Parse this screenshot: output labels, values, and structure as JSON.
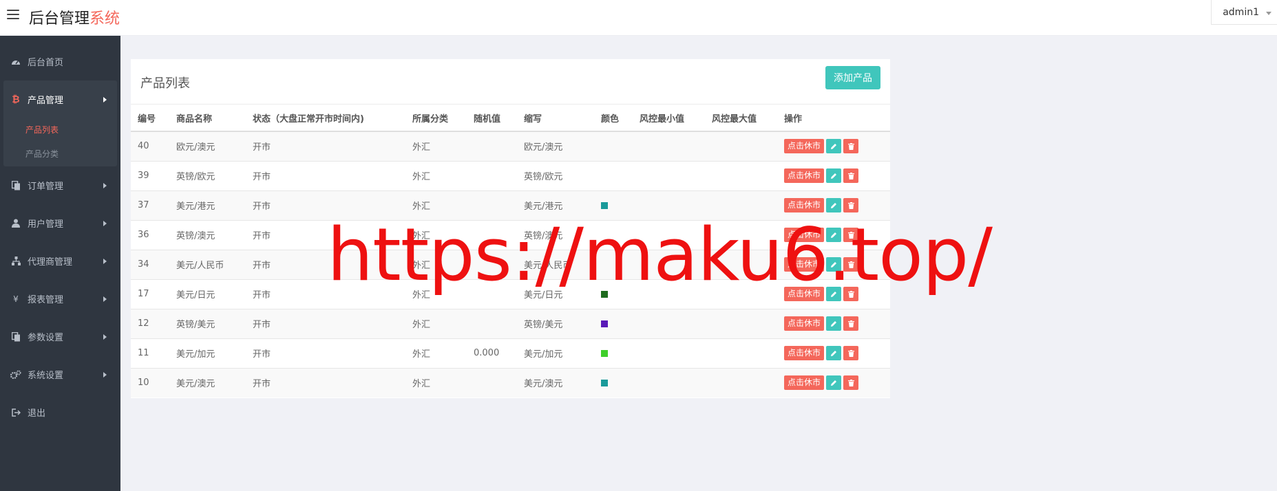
{
  "header": {
    "brand_main": "后台管理",
    "brand_accent": "系统",
    "user": "admin1"
  },
  "sidebar": {
    "items": [
      {
        "label": "后台首页",
        "icon": "dashboard-icon"
      },
      {
        "label": "产品管理",
        "icon": "bitcoin-icon",
        "expanded": true,
        "children": [
          {
            "label": "产品列表",
            "active": true
          },
          {
            "label": "产品分类"
          }
        ]
      },
      {
        "label": "订单管理",
        "icon": "copy-icon"
      },
      {
        "label": "用户管理",
        "icon": "user-icon"
      },
      {
        "label": "代理商管理",
        "icon": "sitemap-icon"
      },
      {
        "label": "报表管理",
        "icon": "yen-icon"
      },
      {
        "label": "参数设置",
        "icon": "copy-icon"
      },
      {
        "label": "系统设置",
        "icon": "gears-icon"
      },
      {
        "label": "退出",
        "icon": "sign-out-icon"
      }
    ]
  },
  "panel": {
    "title": "产品列表",
    "add_button": "添加产品"
  },
  "table": {
    "columns": [
      "编号",
      "商品名称",
      "状态（大盘正常开市时间内)",
      "所属分类",
      "随机值",
      "缩写",
      "颜色",
      "风控最小值",
      "风控最大值",
      "操作"
    ],
    "rows": [
      {
        "id": "40",
        "name": "欧元/澳元",
        "status": "开市",
        "category": "外汇",
        "random": "",
        "abbr": "欧元/澳元",
        "color": ""
      },
      {
        "id": "39",
        "name": "英镑/欧元",
        "status": "开市",
        "category": "外汇",
        "random": "",
        "abbr": "英镑/欧元",
        "color": ""
      },
      {
        "id": "37",
        "name": "美元/港元",
        "status": "开市",
        "category": "外汇",
        "random": "",
        "abbr": "美元/港元",
        "color": "#1a9a9a"
      },
      {
        "id": "36",
        "name": "英镑/澳元",
        "status": "开市",
        "category": "外汇",
        "random": "",
        "abbr": "英镑/澳元",
        "color": ""
      },
      {
        "id": "34",
        "name": "美元/人民币",
        "status": "开市",
        "category": "外汇",
        "random": "",
        "abbr": "美元/人民币",
        "color": ""
      },
      {
        "id": "17",
        "name": "美元/日元",
        "status": "开市",
        "category": "外汇",
        "random": "",
        "abbr": "美元/日元",
        "color": "#1e6b1e"
      },
      {
        "id": "12",
        "name": "英镑/美元",
        "status": "开市",
        "category": "外汇",
        "random": "",
        "abbr": "英镑/美元",
        "color": "#5a1ab8"
      },
      {
        "id": "11",
        "name": "美元/加元",
        "status": "开市",
        "category": "外汇",
        "random": "0.000",
        "abbr": "美元/加元",
        "color": "#3fcf2a"
      },
      {
        "id": "10",
        "name": "美元/澳元",
        "status": "开市",
        "category": "外汇",
        "random": "",
        "abbr": "美元/澳元",
        "color": "#1a9a9a"
      }
    ],
    "action_close_label": "点击休市"
  },
  "watermark": "https://maku6.top/",
  "colors": {
    "accent": "#f4675b",
    "teal": "#40c6bc",
    "sidebar_bg": "#2f3640"
  }
}
